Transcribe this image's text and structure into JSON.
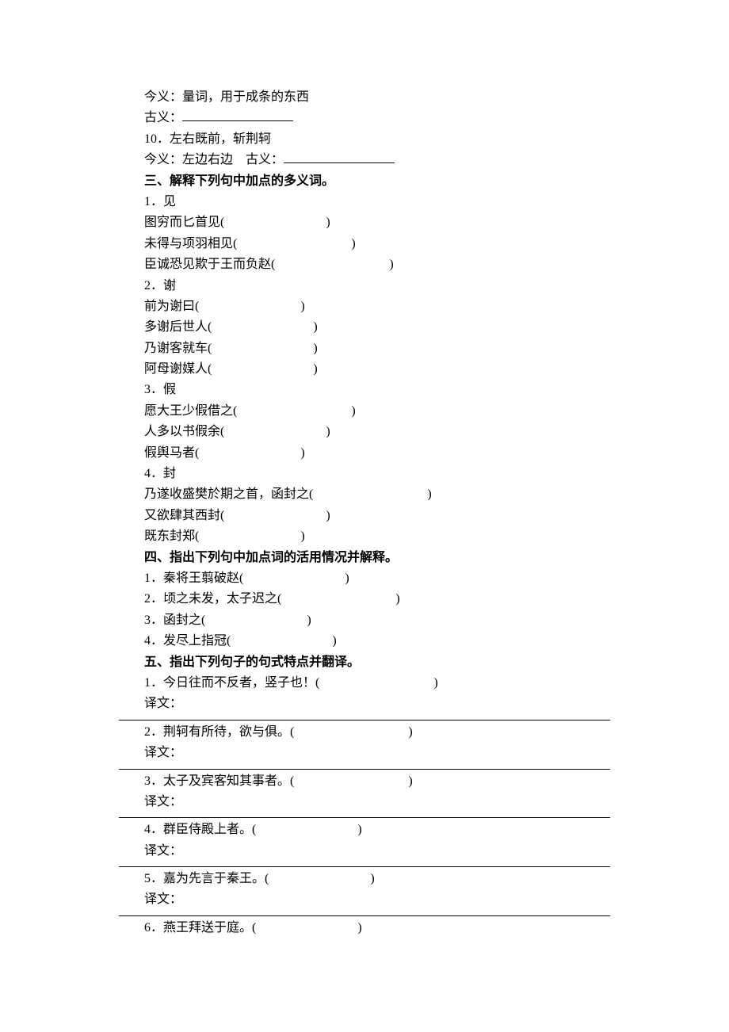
{
  "pre": {
    "l1": "今义：量词，用于成条的东西",
    "l2a": "古义：",
    "l3": "10．左右既前，斩荆轲",
    "l4a": "今义：左边右边　古义："
  },
  "s3": {
    "heading": "三、解释下列句中加点的多义词。",
    "g1": {
      "title": "1．见",
      "a": "图穷而匕首见(",
      "b": "未得与项羽相见(",
      "c": "臣诚恐见欺于王而负赵("
    },
    "g2": {
      "title": "2．谢",
      "a": "前为谢曰(",
      "b": "多谢后世人(",
      "c": "乃谢客就车(",
      "d": "阿母谢媒人("
    },
    "g3": {
      "title": "3．假",
      "a": "愿大王少假借之(",
      "b": "人多以书假余(",
      "c": "假舆马者("
    },
    "g4": {
      "title": "4．封",
      "a": "乃遂收盛樊於期之首，函封之(",
      "b": "又欲肆其西封(",
      "c": "既东封郑("
    }
  },
  "s4": {
    "heading": "四、指出下列句中加点词的活用情况并解释。",
    "a": "1．秦将王翦破赵(",
    "b": "2．顷之未发，太子迟之(",
    "c": "3．函封之(",
    "d": "4．发尽上指冠("
  },
  "s5": {
    "heading": "五、指出下列句子的句式特点并翻译。",
    "q1": "1．今日往而不反者，竖子也！(",
    "q2": "2．荆轲有所待，欲与俱。(",
    "q3": "3．太子及宾客知其事者。(",
    "q4": "4．群臣侍殿上者。(",
    "q5": "5．嘉为先言于秦王。(",
    "q6": "6．燕王拜送于庭。(",
    "yw": "译文：",
    "close": ")"
  }
}
